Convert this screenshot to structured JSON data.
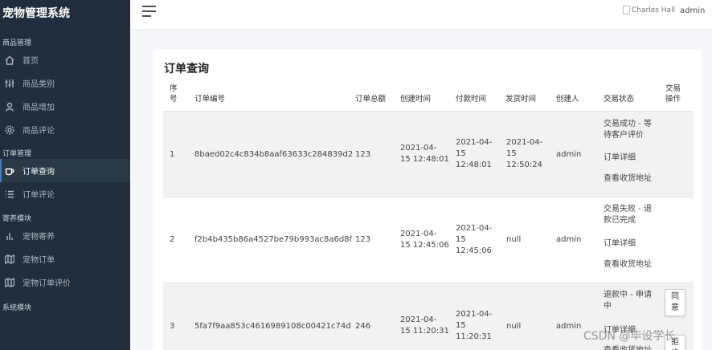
{
  "app": {
    "title": "宠物管理系统"
  },
  "sidebar": {
    "sections": [
      {
        "header": "商品管理",
        "items": [
          {
            "label": "首页",
            "icon": "home-icon"
          },
          {
            "label": "商品类别",
            "icon": "sliders-icon"
          },
          {
            "label": "商品增加",
            "icon": "user-icon"
          },
          {
            "label": "商品评论",
            "icon": "gear-icon"
          }
        ]
      },
      {
        "header": "订单管理",
        "items": [
          {
            "label": "订单查询",
            "icon": "coffee-icon",
            "active": true
          },
          {
            "label": "订单评论",
            "icon": "list-icon"
          }
        ]
      },
      {
        "header": "寄养模块",
        "items": [
          {
            "label": "宠物寄养",
            "icon": "bar-chart-icon"
          },
          {
            "label": "宠物订单",
            "icon": "map-icon"
          },
          {
            "label": "宠物订单评价",
            "icon": "map-icon"
          }
        ]
      },
      {
        "header": "系统模块",
        "items": []
      }
    ]
  },
  "topbar": {
    "avatar_alt": "Charles Hall",
    "username": "admin"
  },
  "page": {
    "title": "订单查询"
  },
  "table": {
    "headers": {
      "seq": "序\n号",
      "order_no": "订单编号",
      "total": "订单总额",
      "created": "创建时间",
      "paid": "付款时间",
      "shipped": "发货时间",
      "creator": "创建人",
      "status": "交易状态",
      "op": "交易\n操作"
    },
    "rows": [
      {
        "seq": "1",
        "order_no": "8baed02c4c834b8aaf63633c284839d2",
        "total": "123",
        "created": "2021-04-\n15 12:48:01",
        "paid": "2021-04-\n15\n12:48:01",
        "shipped": "2021-04-\n15\n12:50:24",
        "creator": "admin",
        "status": "交易成功 - 等\n待客户评价",
        "detail": "订单详细",
        "address": "查看收货地址"
      },
      {
        "seq": "2",
        "order_no": "f2b4b435b86a4527be79b993ac8a6d8f",
        "total": "123",
        "created": "2021-04-\n15 12:45:06",
        "paid": "2021-04-\n15\n12:45:06",
        "shipped": "null",
        "creator": "admin",
        "status": "交易失败 - 退\n款已完成",
        "detail": "订单详细",
        "address": "查看收货地址"
      },
      {
        "seq": "3",
        "order_no": "5fa7f9aa853c4616989108c00421c74d",
        "total": "246",
        "created": "2021-04-\n15 11:20:31",
        "paid": "2021-04-\n15\n11:20:31",
        "shipped": "null",
        "creator": "admin",
        "status": "退款中 - 申请\n中",
        "detail": "订单详细",
        "address": "查看收货地址",
        "agree": "同\n意",
        "reject": "拒\n绝"
      }
    ]
  },
  "watermark": "CSDN @毕设学长"
}
